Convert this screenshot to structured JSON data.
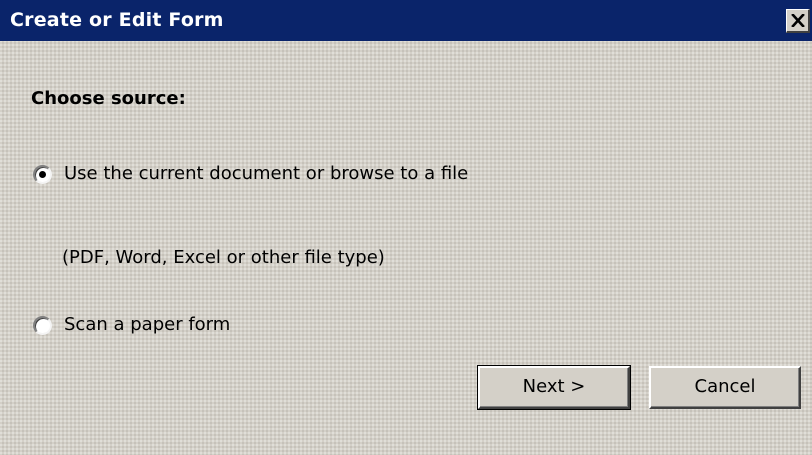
{
  "window": {
    "title": "Create or Edit Form",
    "close_icon": "close-icon"
  },
  "source": {
    "heading": "Choose source:",
    "options": [
      {
        "label": "Use the current document or browse to a file",
        "selected": true
      },
      {
        "label": "Scan a paper form",
        "selected": false
      }
    ],
    "hint": "(PDF, Word, Excel or other file type)"
  },
  "buttons": {
    "next_label": "Next >",
    "cancel_label": "Cancel"
  },
  "colors": {
    "titlebar": "#0a246a",
    "dialog_background": "#d4d0c8"
  }
}
